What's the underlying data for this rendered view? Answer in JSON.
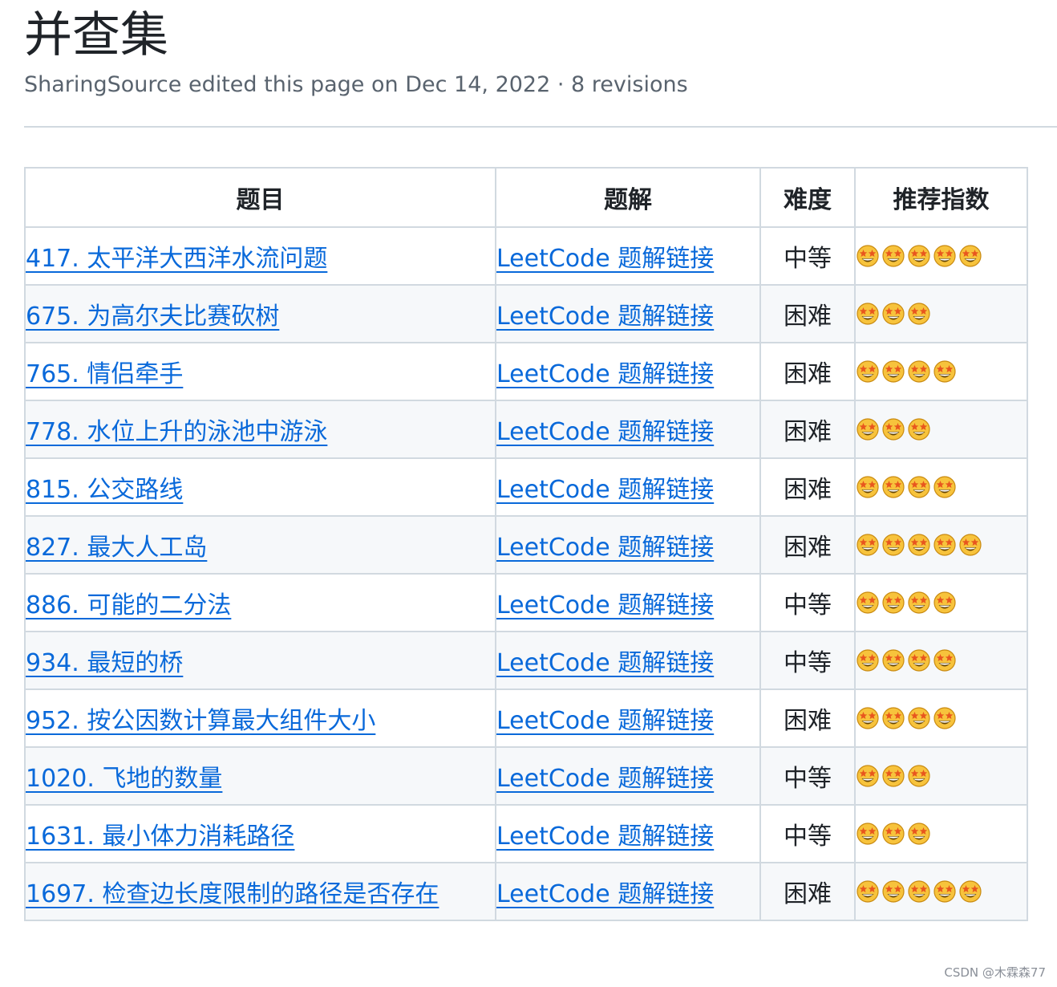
{
  "page": {
    "title": "并查集",
    "subtitle": "SharingSource edited this page on Dec 14, 2022 · 8 revisions"
  },
  "table": {
    "headers": [
      "题目",
      "题解",
      "难度",
      "推荐指数"
    ],
    "rows": [
      {
        "title": "417. 太平洋大西洋水流问题",
        "link": "LeetCode 题解链接",
        "difficulty": "中等",
        "stars": 5
      },
      {
        "title": "675. 为高尔夫比赛砍树",
        "link": "LeetCode 题解链接",
        "difficulty": "困难",
        "stars": 3
      },
      {
        "title": "765. 情侣牵手",
        "link": "LeetCode 题解链接",
        "difficulty": "困难",
        "stars": 4
      },
      {
        "title": "778. 水位上升的泳池中游泳",
        "link": "LeetCode 题解链接",
        "difficulty": "困难",
        "stars": 3
      },
      {
        "title": "815. 公交路线",
        "link": "LeetCode 题解链接",
        "difficulty": "困难",
        "stars": 4
      },
      {
        "title": "827. 最大人工岛",
        "link": "LeetCode 题解链接",
        "difficulty": "困难",
        "stars": 5
      },
      {
        "title": "886. 可能的二分法",
        "link": "LeetCode 题解链接",
        "difficulty": "中等",
        "stars": 4
      },
      {
        "title": "934. 最短的桥",
        "link": "LeetCode 题解链接",
        "difficulty": "中等",
        "stars": 4
      },
      {
        "title": "952. 按公因数计算最大组件大小",
        "link": "LeetCode 题解链接",
        "difficulty": "困难",
        "stars": 4
      },
      {
        "title": "1020. 飞地的数量",
        "link": "LeetCode 题解链接",
        "difficulty": "中等",
        "stars": 3
      },
      {
        "title": "1631. 最小体力消耗路径",
        "link": "LeetCode 题解链接",
        "difficulty": "中等",
        "stars": 3
      },
      {
        "title": "1697. 检查边长度限制的路径是否存在",
        "link": "LeetCode 题解链接",
        "difficulty": "困难",
        "stars": 5
      }
    ]
  },
  "rating_icon": "star-struck-emoji-icon",
  "colors": {
    "link": "#0969da",
    "emoji_face": "#f7c33c",
    "emoji_star": "#e8561e"
  },
  "watermark": "CSDN @木霖森77"
}
